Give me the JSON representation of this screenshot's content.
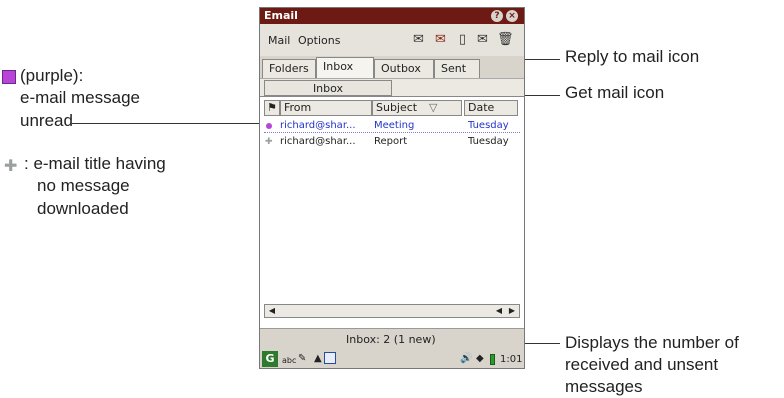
{
  "device": {
    "title": "Email",
    "menu": [
      "Mail",
      "Options"
    ],
    "tabs": [
      {
        "label": "Folders",
        "active": false
      },
      {
        "label": "Inbox",
        "active": true
      },
      {
        "label": "Outbox",
        "active": false
      },
      {
        "label": "Sent",
        "active": false
      }
    ],
    "folder_selector": "Inbox",
    "columns": {
      "flag": "⚑",
      "from": "From",
      "subject": "Subject",
      "sort_indicator": "▽",
      "date": "Date"
    },
    "rows": [
      {
        "status": "unread",
        "from": "richard@shar...",
        "subject": "Meeting",
        "date": "Tuesday"
      },
      {
        "status": "not-downloaded",
        "from": "richard@shar...",
        "subject": "Report",
        "date": "Tuesday"
      }
    ],
    "status_text": "Inbox: 2 (1 new)",
    "taskbar": {
      "input_mode": "abc",
      "clock": "1:01"
    }
  },
  "annotations": {
    "purple_line1": "(purple):",
    "purple_line2": "e-mail message",
    "purple_line3": "unread",
    "grey_line1": ": e-mail title having",
    "grey_line2": "no message",
    "grey_line3": "downloaded",
    "reply_label": "Reply to mail icon",
    "get_label": "Get mail icon",
    "count_line1": "Displays the number of",
    "count_line2": "received and unsent",
    "count_line3": "messages"
  },
  "colors": {
    "titlebar": "#6e1a14",
    "unread_text": "#2233cc",
    "unread_icon": "#b844d8"
  }
}
